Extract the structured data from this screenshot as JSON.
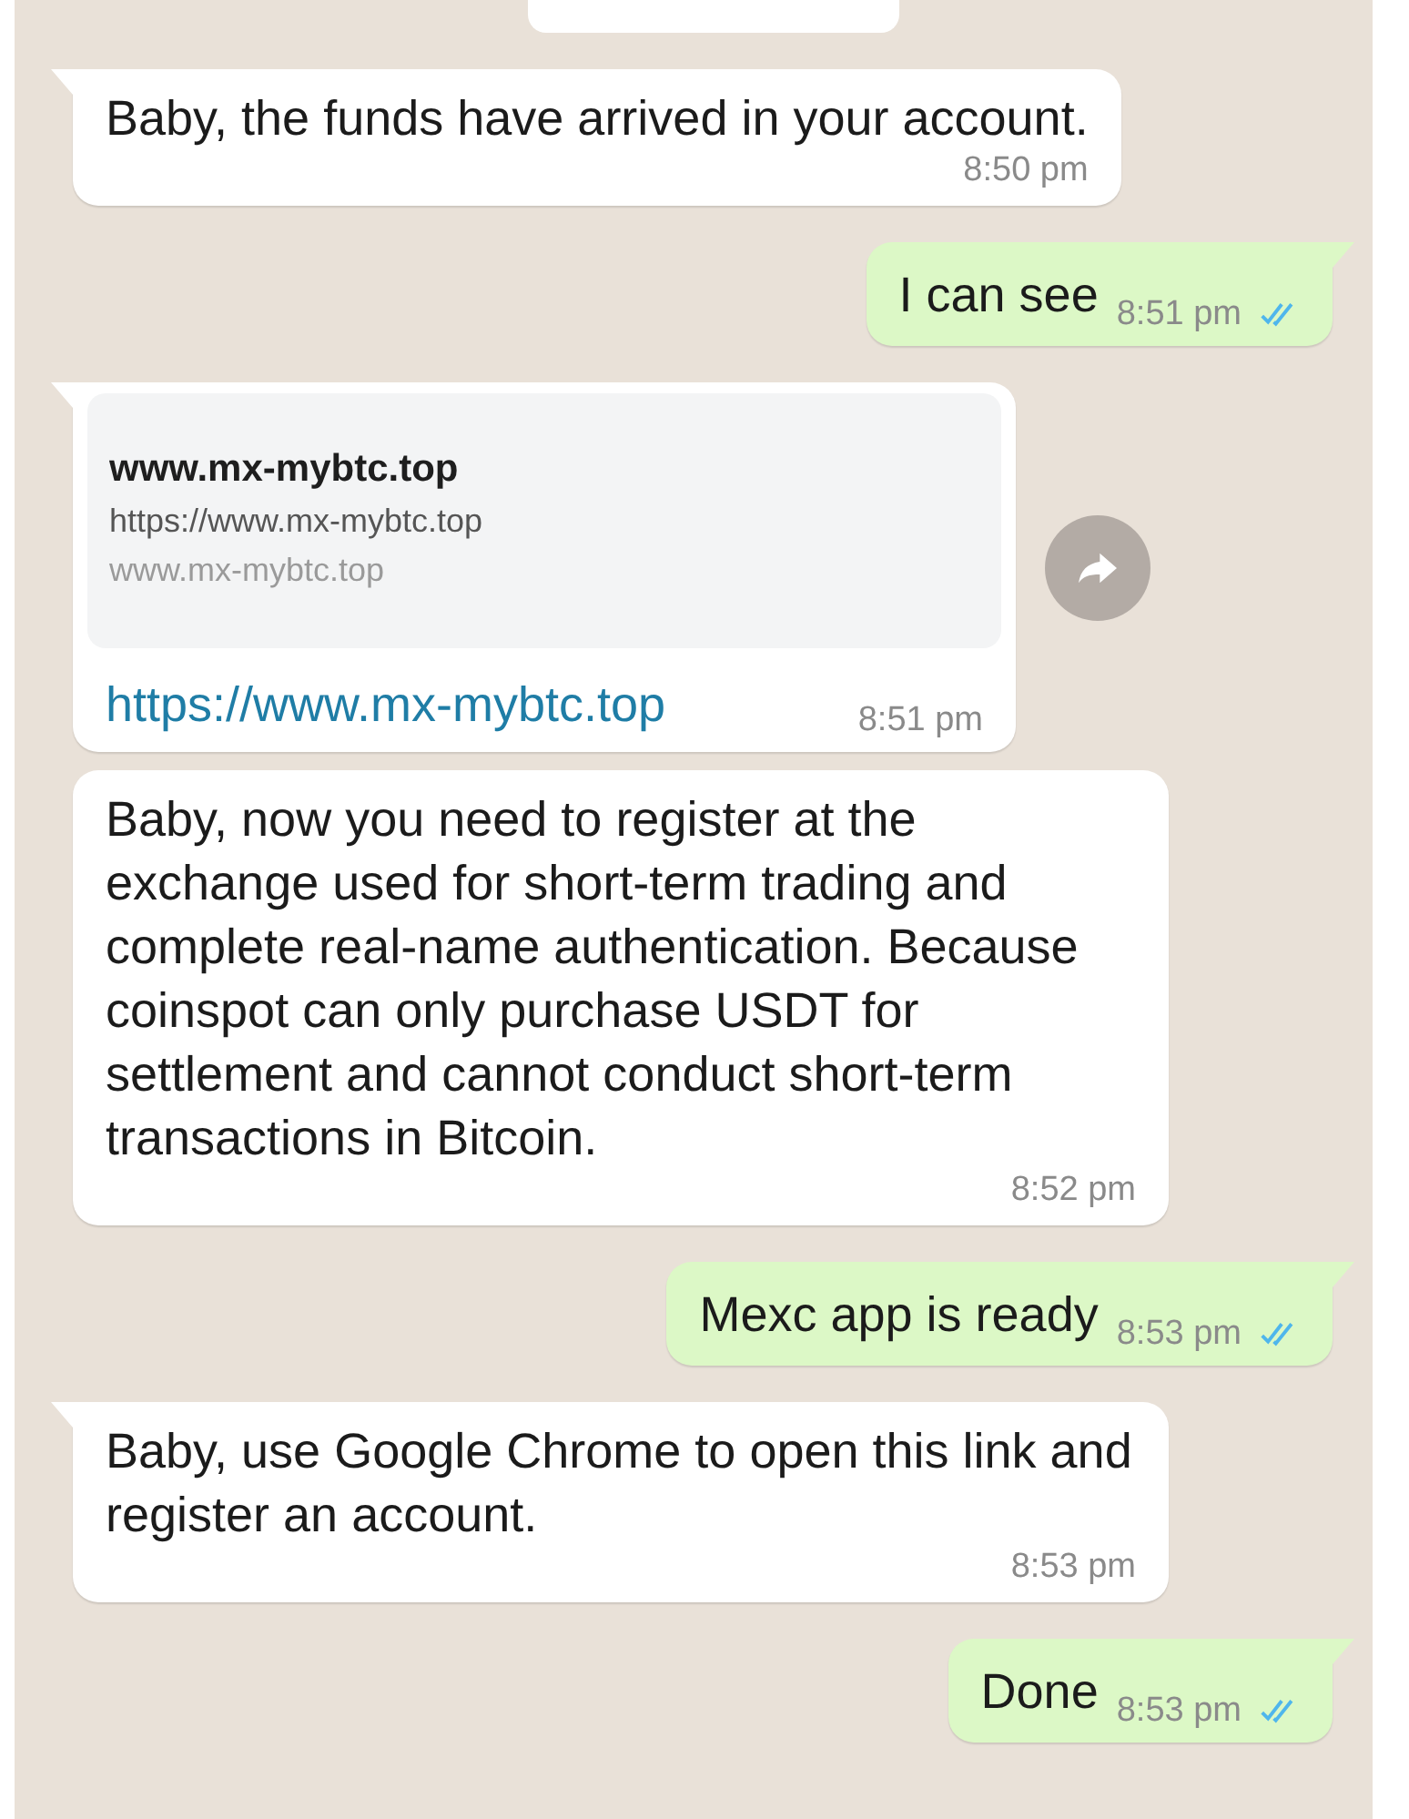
{
  "messages": [
    {
      "kind": "partial"
    },
    {
      "kind": "incoming",
      "tail": true,
      "text": "Baby, the funds have arrived in your account.",
      "time": "8:50 pm"
    },
    {
      "kind": "outgoing",
      "tail": true,
      "text": "I can see",
      "time": "8:51 pm",
      "read": true
    },
    {
      "kind": "link",
      "tail": true,
      "preview": {
        "title": "www.mx-mybtc.top",
        "url": "https://www.mx-mybtc.top",
        "domain": "www.mx-mybtc.top"
      },
      "text": "https://www.mx-mybtc.top",
      "time": "8:51 pm",
      "forward": true
    },
    {
      "kind": "incoming",
      "tail": false,
      "text": "Baby, now you need to register at the exchange used for short-term trading and complete real-name authentication. Because coinspot can only purchase USDT for settlement and cannot conduct short-term transactions in Bitcoin.",
      "time": "8:52 pm"
    },
    {
      "kind": "outgoing",
      "tail": true,
      "text": "Mexc app is ready",
      "time": "8:53 pm",
      "read": true
    },
    {
      "kind": "incoming",
      "tail": true,
      "text": "Baby, use Google Chrome to open this link and register an account.",
      "time": "8:53 pm"
    },
    {
      "kind": "outgoing",
      "tail": true,
      "text": "Done",
      "time": "8:53 pm",
      "read": true
    }
  ]
}
